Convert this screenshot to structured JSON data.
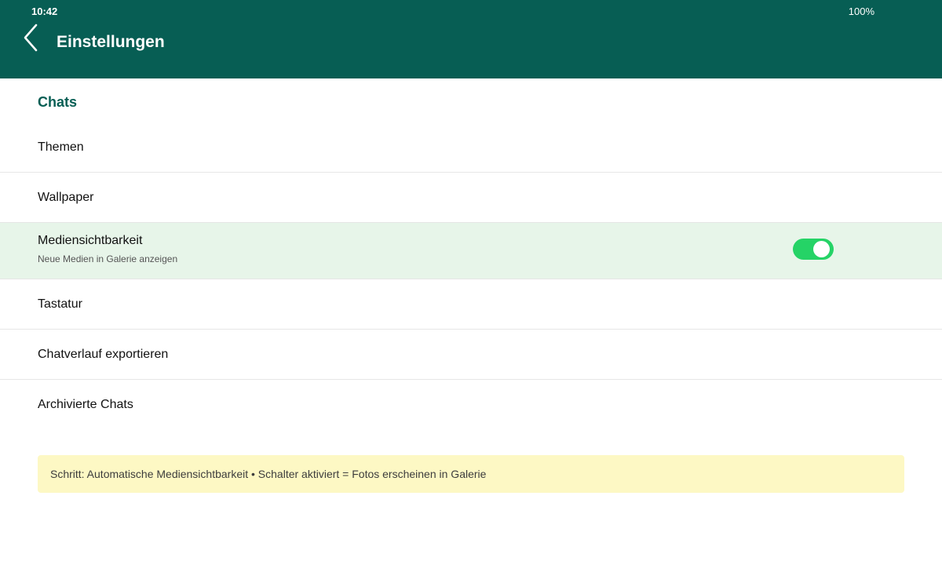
{
  "status": {
    "time": "10:42",
    "battery": "100%"
  },
  "header": {
    "title": "Einstellungen",
    "back_icon": "chevron-left-icon"
  },
  "section": {
    "title": "Chats"
  },
  "items": [
    {
      "label": "Themen"
    },
    {
      "label": "Wallpaper"
    },
    {
      "label": "Mediensichtbarkeit",
      "sublabel": "Neue Medien in Galerie anzeigen",
      "toggle_on": true
    },
    {
      "label": "Tastatur"
    },
    {
      "label": "Chatverlauf exportieren"
    },
    {
      "label": "Archivierte Chats"
    }
  ],
  "hint": {
    "text": "Schritt: Automatische Mediensichtbarkeit • Schalter aktiviert = Fotos erscheinen in Galerie"
  },
  "colors": {
    "header_bg": "#075e54",
    "accent": "#075e54",
    "toggle_on": "#25d366",
    "highlight_bg": "#e7f5e9",
    "hint_bg": "#fdf8c4"
  }
}
